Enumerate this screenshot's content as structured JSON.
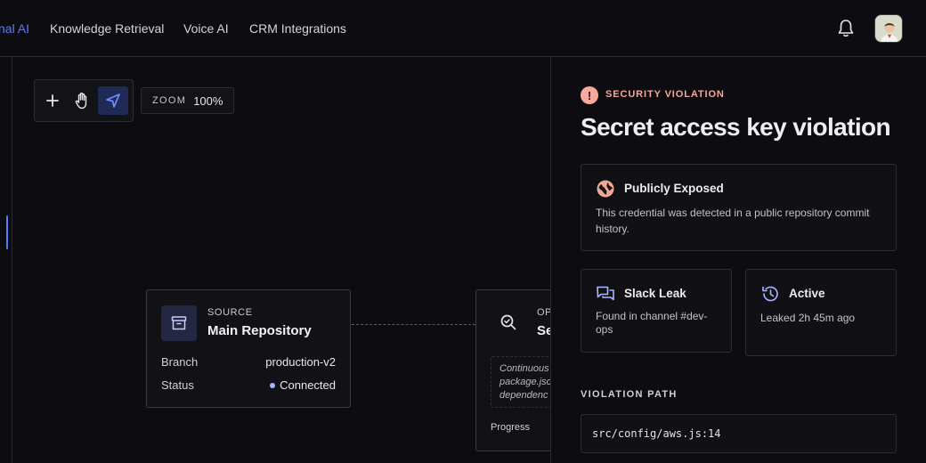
{
  "nav": {
    "items": [
      {
        "label": "nal AI",
        "active": true
      },
      {
        "label": "Knowledge Retrieval",
        "active": false
      },
      {
        "label": "Voice AI",
        "active": false
      },
      {
        "label": "CRM Integrations",
        "active": false
      }
    ]
  },
  "icons": {
    "notifications": "bell-icon",
    "profile": "avatar"
  },
  "canvas": {
    "tools": [
      "plus-icon",
      "hand-icon",
      "pointer-icon"
    ],
    "active_tool": "pointer-icon",
    "zoom": {
      "label": "ZOOM",
      "value": "100%"
    },
    "source_node": {
      "kicker": "SOURCE",
      "title": "Main Repository",
      "rows": [
        {
          "key": "Branch",
          "value": "production-v2"
        },
        {
          "key": "Status",
          "value": "Connected"
        }
      ]
    },
    "ops_node": {
      "kicker": "OP",
      "title": "Se",
      "note_lines": [
        "Continuous",
        "package.jso",
        "dependenc"
      ],
      "progress_label": "Progress"
    }
  },
  "panel": {
    "kicker": "SECURITY VIOLATION",
    "title": "Secret access key violation",
    "exposed": {
      "title": "Publicly Exposed",
      "body": "This credential was detected in a public repository commit history."
    },
    "slack": {
      "title": "Slack Leak",
      "body": "Found in channel #dev-ops"
    },
    "status": {
      "title": "Active",
      "body": "Leaked 2h 45m ago"
    },
    "path_label": "VIOLATION PATH",
    "path_value": "src/config/aws.js:14"
  },
  "colors": {
    "accent": "#5b7bff",
    "danger": "#f4a798",
    "background": "#0d0d11"
  }
}
